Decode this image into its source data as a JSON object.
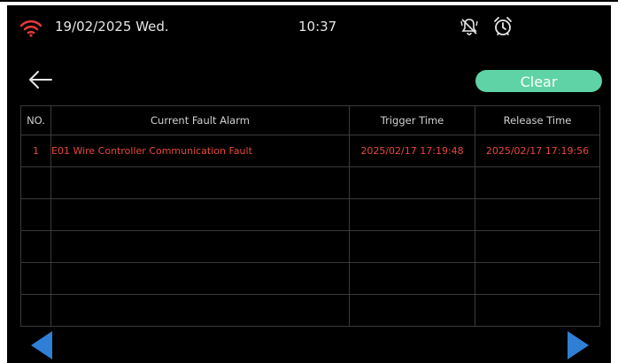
{
  "status_bar": {
    "date": "19/02/2025 Wed.",
    "time": "10:37"
  },
  "toolbar": {
    "clear_label": "Clear"
  },
  "alarm_table": {
    "columns": [
      "NO.",
      "Current Fault Alarm",
      "Trigger Time",
      "Release Time"
    ],
    "rows": [
      [
        "1",
        "E01 Wire Controller Communication Fault",
        "2025/02/17 17:19:48",
        "2025/02/17 17:19:56"
      ],
      [
        "",
        "",
        "",
        ""
      ],
      [
        "",
        "",
        "",
        ""
      ],
      [
        "",
        "",
        "",
        ""
      ],
      [
        "",
        "",
        "",
        ""
      ],
      [
        "",
        "",
        "",
        ""
      ]
    ]
  },
  "colors": {
    "background": "#000000",
    "accent": "#5fd3a6",
    "fault_text": "#e8473d",
    "wifi": "#e0393c",
    "nav_arrow": "#2f7fd6"
  },
  "icons": {
    "wifi": "wifi-icon",
    "bell": "bell-muted-icon",
    "alarm": "alarm-clock-icon",
    "back": "back-arrow-icon",
    "prev": "prev-page-icon",
    "next": "next-page-icon"
  }
}
